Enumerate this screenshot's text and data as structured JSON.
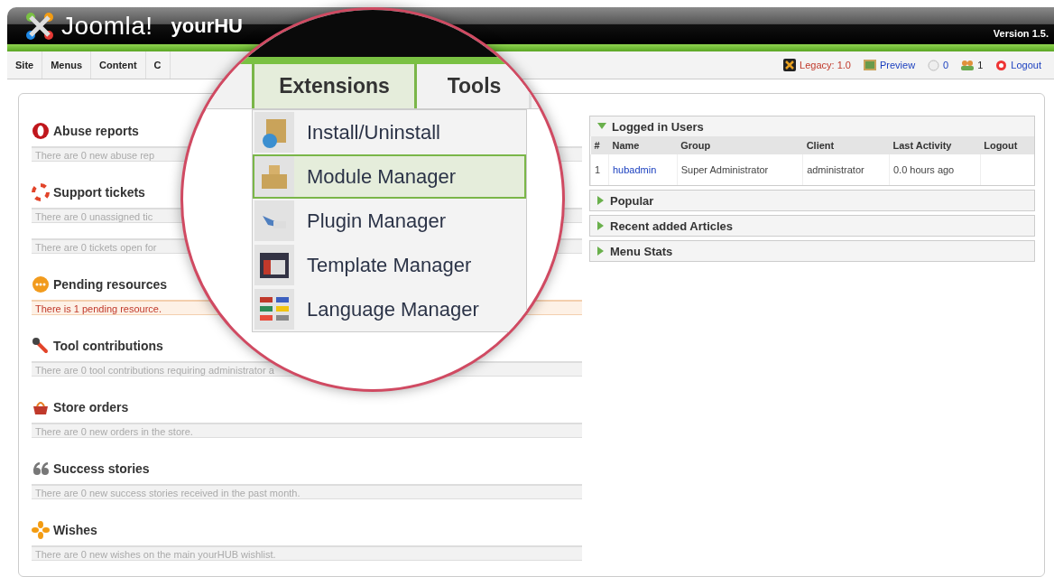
{
  "header": {
    "logo": "Joomla!",
    "site_name": "yourHU",
    "version": "Version 1.5."
  },
  "menu": [
    {
      "label": "Site"
    },
    {
      "label": "Menus"
    },
    {
      "label": "Content"
    },
    {
      "label": "C"
    }
  ],
  "status": [
    {
      "kind": "legacy",
      "label": "Legacy: 1.0"
    },
    {
      "kind": "preview",
      "label": "Preview"
    },
    {
      "kind": "messages",
      "label": "0"
    },
    {
      "kind": "users",
      "label": "1"
    },
    {
      "kind": "logout",
      "label": "Logout"
    }
  ],
  "sections": [
    {
      "kind": "abuse",
      "title": "Abuse reports",
      "messages": [
        {
          "text": "There are 0 new abuse rep",
          "alert": false
        }
      ]
    },
    {
      "kind": "support",
      "title": "Support tickets",
      "messages": [
        {
          "text": "There are 0 unassigned tic",
          "alert": false
        },
        {
          "text": "There are 0 tickets open for",
          "alert": false
        }
      ]
    },
    {
      "kind": "pending",
      "title": "Pending resources",
      "messages": [
        {
          "text": "There is 1 pending resource.",
          "alert": true
        }
      ]
    },
    {
      "kind": "tools",
      "title": "Tool contributions",
      "messages": [
        {
          "text": "There are 0 tool contributions requiring administrator a",
          "alert": false
        }
      ]
    },
    {
      "kind": "store",
      "title": "Store orders",
      "messages": [
        {
          "text": "There are 0 new orders in the store.",
          "alert": false
        }
      ]
    },
    {
      "kind": "stories",
      "title": "Success stories",
      "messages": [
        {
          "text": "There are 0 new success stories received in the past month.",
          "alert": false
        }
      ]
    },
    {
      "kind": "wishes",
      "title": "Wishes",
      "messages": [
        {
          "text": "There are 0 new wishes on the main yourHUB wishlist.",
          "alert": false
        }
      ]
    }
  ],
  "panels": [
    {
      "title": "Logged in Users",
      "expanded": true,
      "table": {
        "columns": [
          "#",
          "Name",
          "Group",
          "Client",
          "Last Activity",
          "Logout"
        ],
        "rows": [
          {
            "cells": [
              "1",
              "hubadmin",
              "Super Administrator",
              "administrator",
              "0.0 hours ago"
            ]
          }
        ]
      }
    },
    {
      "title": "Popular",
      "expanded": false
    },
    {
      "title": "Recent added Articles",
      "expanded": false
    },
    {
      "title": "Menu Stats",
      "expanded": false
    }
  ],
  "magnifier": {
    "tabs": [
      {
        "label": "Extensions",
        "selected": true
      },
      {
        "label": "Tools",
        "selected": false
      }
    ],
    "items": [
      {
        "kind": "install",
        "label": "Install/Uninstall",
        "selected": false
      },
      {
        "kind": "module",
        "label": "Module Manager",
        "selected": true
      },
      {
        "kind": "plugin",
        "label": "Plugin Manager",
        "selected": false
      },
      {
        "kind": "template",
        "label": "Template Manager",
        "selected": false
      },
      {
        "kind": "language",
        "label": "Language Manager",
        "selected": false
      }
    ]
  }
}
